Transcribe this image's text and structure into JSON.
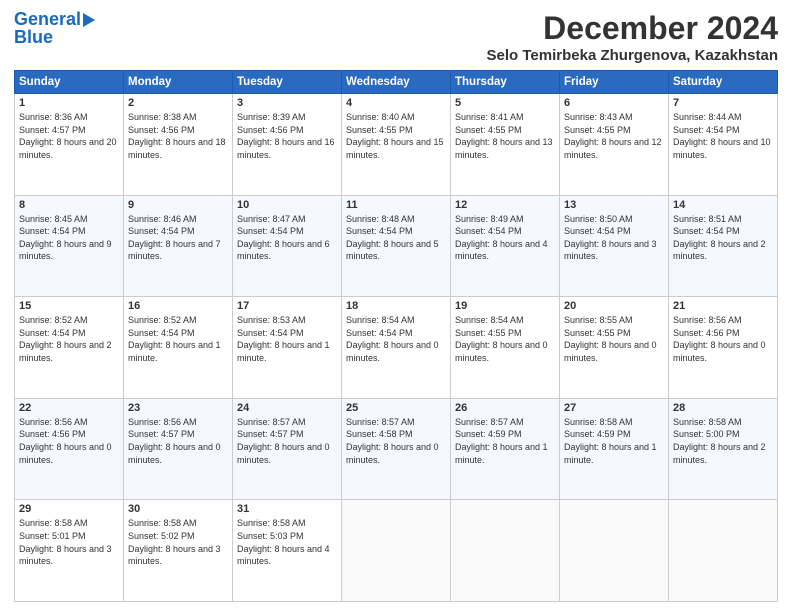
{
  "logo": {
    "line1": "General",
    "line2": "Blue"
  },
  "title": "December 2024",
  "location": "Selo Temirbeka Zhurgenova, Kazakhstan",
  "days_header": [
    "Sunday",
    "Monday",
    "Tuesday",
    "Wednesday",
    "Thursday",
    "Friday",
    "Saturday"
  ],
  "weeks": [
    [
      {
        "day": "1",
        "sunrise": "8:36 AM",
        "sunset": "4:57 PM",
        "daylight": "8 hours and 20 minutes."
      },
      {
        "day": "2",
        "sunrise": "8:38 AM",
        "sunset": "4:56 PM",
        "daylight": "8 hours and 18 minutes."
      },
      {
        "day": "3",
        "sunrise": "8:39 AM",
        "sunset": "4:56 PM",
        "daylight": "8 hours and 16 minutes."
      },
      {
        "day": "4",
        "sunrise": "8:40 AM",
        "sunset": "4:55 PM",
        "daylight": "8 hours and 15 minutes."
      },
      {
        "day": "5",
        "sunrise": "8:41 AM",
        "sunset": "4:55 PM",
        "daylight": "8 hours and 13 minutes."
      },
      {
        "day": "6",
        "sunrise": "8:43 AM",
        "sunset": "4:55 PM",
        "daylight": "8 hours and 12 minutes."
      },
      {
        "day": "7",
        "sunrise": "8:44 AM",
        "sunset": "4:54 PM",
        "daylight": "8 hours and 10 minutes."
      }
    ],
    [
      {
        "day": "8",
        "sunrise": "8:45 AM",
        "sunset": "4:54 PM",
        "daylight": "8 hours and 9 minutes."
      },
      {
        "day": "9",
        "sunrise": "8:46 AM",
        "sunset": "4:54 PM",
        "daylight": "8 hours and 7 minutes."
      },
      {
        "day": "10",
        "sunrise": "8:47 AM",
        "sunset": "4:54 PM",
        "daylight": "8 hours and 6 minutes."
      },
      {
        "day": "11",
        "sunrise": "8:48 AM",
        "sunset": "4:54 PM",
        "daylight": "8 hours and 5 minutes."
      },
      {
        "day": "12",
        "sunrise": "8:49 AM",
        "sunset": "4:54 PM",
        "daylight": "8 hours and 4 minutes."
      },
      {
        "day": "13",
        "sunrise": "8:50 AM",
        "sunset": "4:54 PM",
        "daylight": "8 hours and 3 minutes."
      },
      {
        "day": "14",
        "sunrise": "8:51 AM",
        "sunset": "4:54 PM",
        "daylight": "8 hours and 2 minutes."
      }
    ],
    [
      {
        "day": "15",
        "sunrise": "8:52 AM",
        "sunset": "4:54 PM",
        "daylight": "8 hours and 2 minutes."
      },
      {
        "day": "16",
        "sunrise": "8:52 AM",
        "sunset": "4:54 PM",
        "daylight": "8 hours and 1 minute."
      },
      {
        "day": "17",
        "sunrise": "8:53 AM",
        "sunset": "4:54 PM",
        "daylight": "8 hours and 1 minute."
      },
      {
        "day": "18",
        "sunrise": "8:54 AM",
        "sunset": "4:54 PM",
        "daylight": "8 hours and 0 minutes."
      },
      {
        "day": "19",
        "sunrise": "8:54 AM",
        "sunset": "4:55 PM",
        "daylight": "8 hours and 0 minutes."
      },
      {
        "day": "20",
        "sunrise": "8:55 AM",
        "sunset": "4:55 PM",
        "daylight": "8 hours and 0 minutes."
      },
      {
        "day": "21",
        "sunrise": "8:56 AM",
        "sunset": "4:56 PM",
        "daylight": "8 hours and 0 minutes."
      }
    ],
    [
      {
        "day": "22",
        "sunrise": "8:56 AM",
        "sunset": "4:56 PM",
        "daylight": "8 hours and 0 minutes."
      },
      {
        "day": "23",
        "sunrise": "8:56 AM",
        "sunset": "4:57 PM",
        "daylight": "8 hours and 0 minutes."
      },
      {
        "day": "24",
        "sunrise": "8:57 AM",
        "sunset": "4:57 PM",
        "daylight": "8 hours and 0 minutes."
      },
      {
        "day": "25",
        "sunrise": "8:57 AM",
        "sunset": "4:58 PM",
        "daylight": "8 hours and 0 minutes."
      },
      {
        "day": "26",
        "sunrise": "8:57 AM",
        "sunset": "4:59 PM",
        "daylight": "8 hours and 1 minute."
      },
      {
        "day": "27",
        "sunrise": "8:58 AM",
        "sunset": "4:59 PM",
        "daylight": "8 hours and 1 minute."
      },
      {
        "day": "28",
        "sunrise": "8:58 AM",
        "sunset": "5:00 PM",
        "daylight": "8 hours and 2 minutes."
      }
    ],
    [
      {
        "day": "29",
        "sunrise": "8:58 AM",
        "sunset": "5:01 PM",
        "daylight": "8 hours and 3 minutes."
      },
      {
        "day": "30",
        "sunrise": "8:58 AM",
        "sunset": "5:02 PM",
        "daylight": "8 hours and 3 minutes."
      },
      {
        "day": "31",
        "sunrise": "8:58 AM",
        "sunset": "5:03 PM",
        "daylight": "8 hours and 4 minutes."
      },
      null,
      null,
      null,
      null
    ]
  ]
}
